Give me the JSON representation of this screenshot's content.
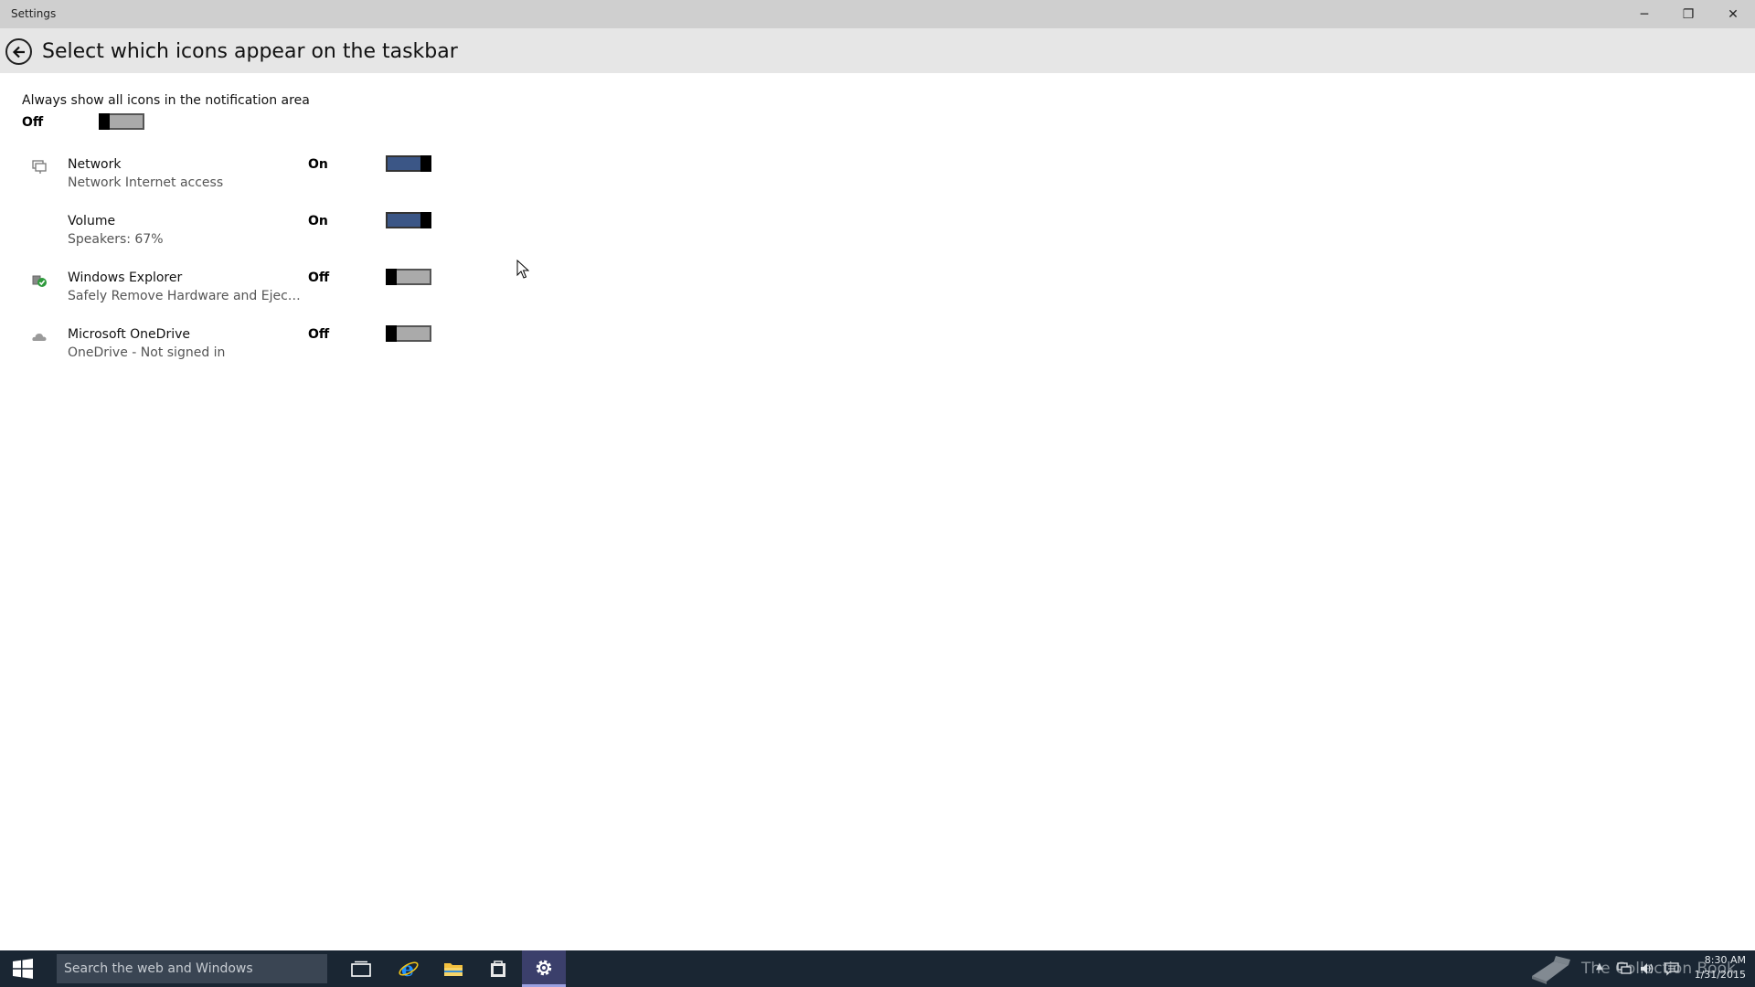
{
  "window": {
    "app_title": "Settings",
    "minimize_glyph": "─",
    "maximize_glyph": "❐",
    "close_glyph": "✕"
  },
  "header": {
    "title": "Select which icons appear on the taskbar",
    "back_icon": "back-arrow-icon"
  },
  "always_show": {
    "label": "Always show all icons in the notification area",
    "state": "Off",
    "value": false
  },
  "items": [
    {
      "name": "Network",
      "description": "Network Internet access",
      "state": "On",
      "value": true,
      "icon": "network-icon"
    },
    {
      "name": "Volume",
      "description": "Speakers: 67%",
      "state": "On",
      "value": true,
      "icon": ""
    },
    {
      "name": "Windows Explorer",
      "description": "Safely Remove Hardware and Eject M...",
      "state": "Off",
      "value": false,
      "icon": "usb-eject-icon"
    },
    {
      "name": "Microsoft OneDrive",
      "description": "OneDrive - Not signed in",
      "state": "Off",
      "value": false,
      "icon": "onedrive-cloud-icon"
    }
  ],
  "taskbar": {
    "search_placeholder": "Search the web and Windows",
    "apps": [
      "task-view-icon",
      "internet-explorer-icon",
      "file-explorer-icon",
      "store-icon",
      "settings-gear-icon"
    ],
    "active_app": "settings-gear-icon",
    "watermark_text": "The Collection Book",
    "clock_time": "8:30 AM",
    "clock_date": "1/31/2015"
  },
  "colors": {
    "toggle_on": "#3b5686",
    "toggle_off": "#aaaaaa",
    "header_bg": "#e6e6e6",
    "taskbar_bg": "#1a2633"
  }
}
